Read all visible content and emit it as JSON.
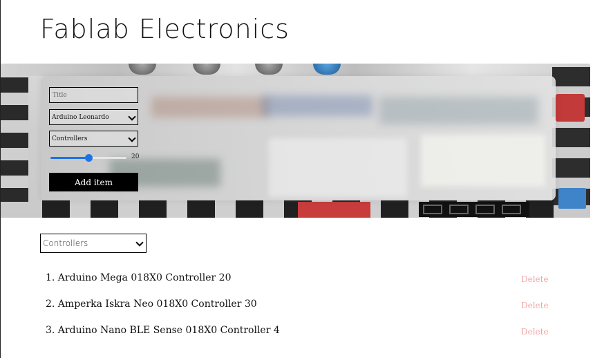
{
  "header": {
    "title": "Fablab Electronics"
  },
  "form": {
    "title_placeholder": "Title",
    "board_select": {
      "selected": "Arduino Leonardo"
    },
    "category_select": {
      "selected": "Controllers"
    },
    "quantity_slider": {
      "value": 20,
      "min": 0,
      "max": 40
    },
    "add_button_label": "Add item"
  },
  "filter": {
    "selected": "Controllers"
  },
  "items": [
    {
      "text": "1. Arduino Mega 018X0 Controller 20",
      "delete_label": "Delete"
    },
    {
      "text": "2. Amperka Iskra Neo 018X0 Controller 30",
      "delete_label": "Delete"
    },
    {
      "text": "3. Arduino Nano BLE Sense 018X0 Controller 4",
      "delete_label": "Delete"
    }
  ],
  "colors": {
    "accent": "#1a73e8",
    "delete": "#f3a6a6",
    "button_bg": "#000000"
  }
}
